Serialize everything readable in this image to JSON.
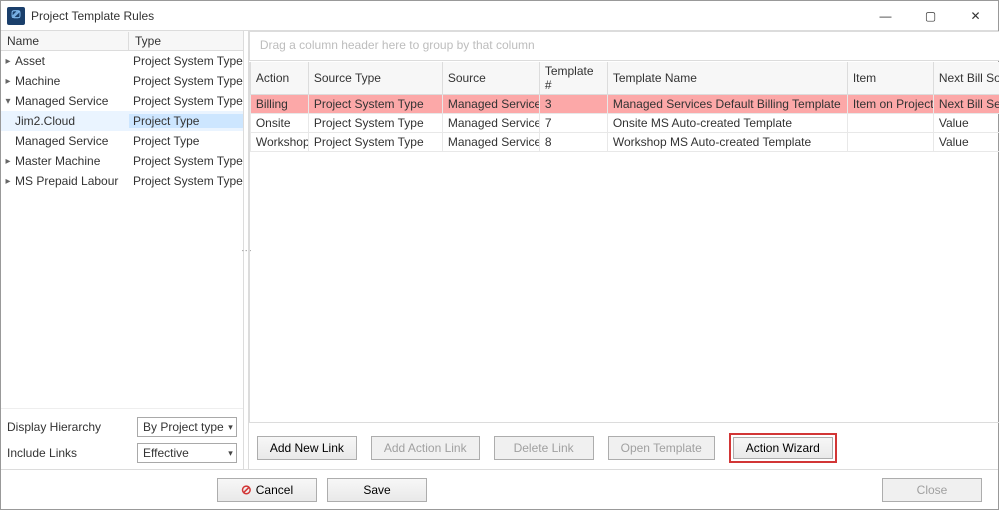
{
  "window": {
    "title": "Project Template Rules"
  },
  "window_controls": {
    "min": "—",
    "max": "▢",
    "close": "✕"
  },
  "tree": {
    "headers": {
      "name": "Name",
      "type": "Type"
    },
    "rows": [
      {
        "exp": "▸",
        "indent": 1,
        "name": "Asset",
        "type": "Project System Type",
        "selected": false
      },
      {
        "exp": "▸",
        "indent": 1,
        "name": "Machine",
        "type": "Project System Type",
        "selected": false
      },
      {
        "exp": "▾",
        "indent": 1,
        "name": "Managed Service",
        "type": "Project System Type",
        "selected": false
      },
      {
        "exp": "",
        "indent": 2,
        "name": "Jim2.Cloud",
        "type": "Project Type",
        "selected": true
      },
      {
        "exp": "",
        "indent": 2,
        "name": "Managed Service",
        "type": "Project Type",
        "selected": false
      },
      {
        "exp": "▸",
        "indent": 1,
        "name": "Master Machine",
        "type": "Project System Type",
        "selected": false
      },
      {
        "exp": "▸",
        "indent": 1,
        "name": "MS Prepaid Labour",
        "type": "Project System Type",
        "selected": false
      }
    ]
  },
  "left_controls": {
    "hierarchy_label": "Display Hierarchy",
    "hierarchy_value": "By Project type",
    "include_label": "Include Links",
    "include_value": "Effective"
  },
  "grid": {
    "group_hint": "Drag a column header here to group by that column",
    "headers": {
      "action": "Action",
      "stype": "Source Type",
      "source": "Source",
      "tnum": "Template #",
      "tname": "Template Name",
      "item": "Item",
      "nbs": "Next Bill Source"
    },
    "rows": [
      {
        "hi": true,
        "action": "Billing",
        "stype": "Project System Type",
        "source": "Managed Service",
        "tnum": "3",
        "tname": "Managed Services Default Billing Template",
        "item": "Item on Project",
        "nbs": "Next Bill Settings on Project"
      },
      {
        "hi": false,
        "action": "Onsite",
        "stype": "Project System Type",
        "source": "Managed Service",
        "tnum": "7",
        "tname": "Onsite MS Auto-created Template",
        "item": "",
        "nbs": "Value"
      },
      {
        "hi": false,
        "action": "Workshop",
        "stype": "Project System Type",
        "source": "Managed Service",
        "tnum": "8",
        "tname": "Workshop MS Auto-created Template",
        "item": "",
        "nbs": "Value"
      }
    ]
  },
  "buttons": {
    "add_new": "Add New Link",
    "add_action": "Add Action Link",
    "delete": "Delete Link",
    "open_tpl": "Open Template",
    "wizard": "Action Wizard",
    "cancel": "Cancel",
    "save": "Save",
    "close": "Close"
  }
}
